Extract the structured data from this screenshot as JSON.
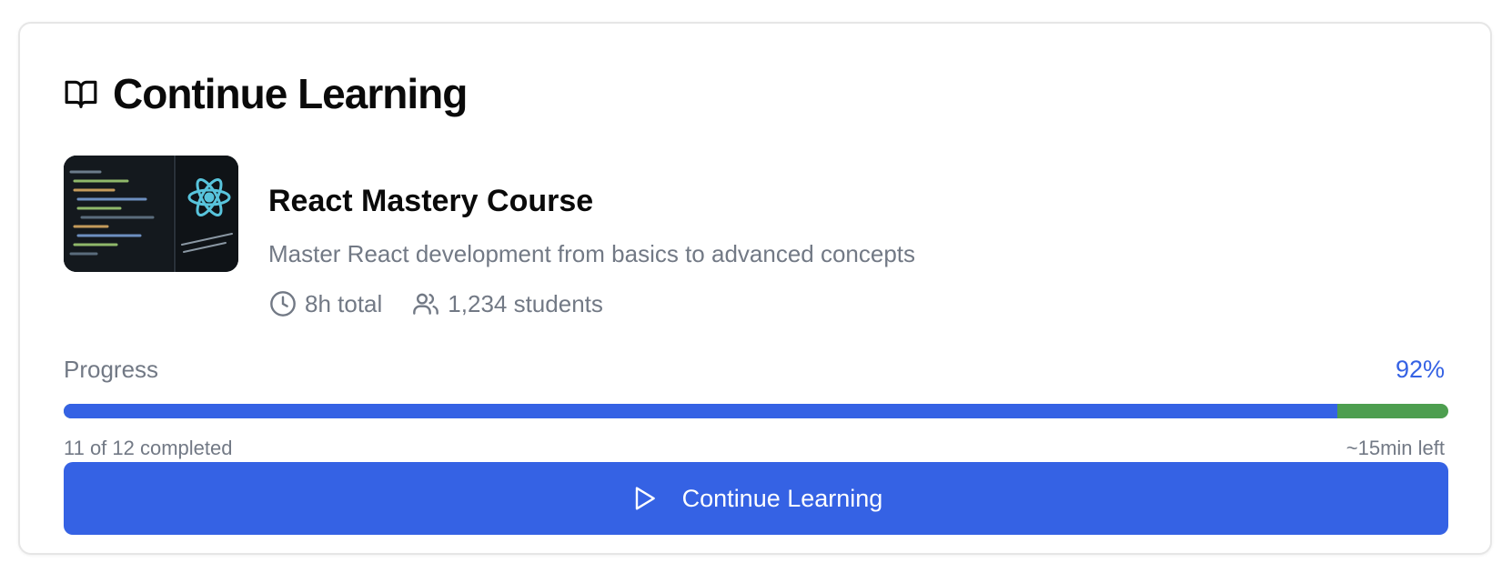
{
  "header": {
    "title": "Continue Learning",
    "icon": "book-open-icon"
  },
  "course": {
    "title": "React Mastery Course",
    "description": "Master React development from basics to advanced concepts",
    "duration": "8h total",
    "students": "1,234 students",
    "thumbnail_icon": "react-logo-icon"
  },
  "progress": {
    "label": "Progress",
    "percent_label": "92%",
    "fraction": 0.92,
    "completed": "11 of 12 completed",
    "time_left": "~15min left"
  },
  "cta": {
    "label": "Continue Learning",
    "icon": "play-icon"
  },
  "colors": {
    "accent": "#3562e4",
    "remaining": "#4d9e4f",
    "muted_text": "#727985"
  }
}
